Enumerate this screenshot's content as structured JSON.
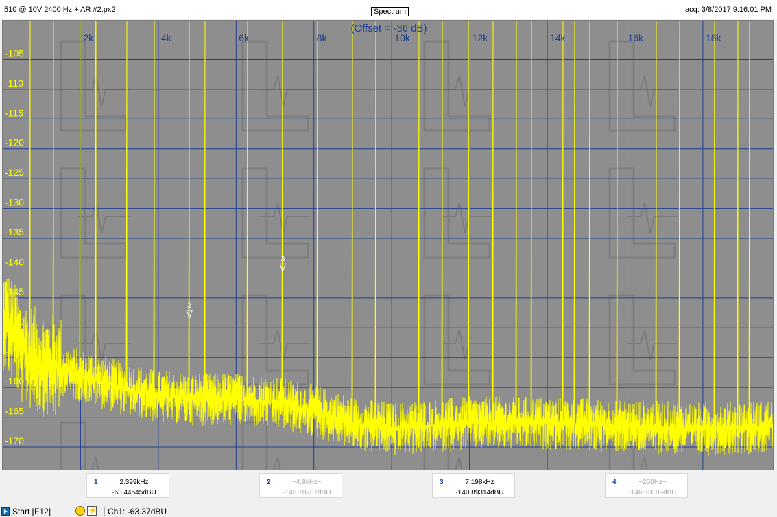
{
  "window": {
    "file_title": "510 @ 10V 2400 Hz + AR #2.px2",
    "view_label": "Spectrum",
    "acq_time": "acq: 3/8/2017 9:16:01 PM"
  },
  "chart_data": {
    "type": "line",
    "title": "(Offset = -36 dB)",
    "xlabel": "",
    "ylabel": "",
    "xlim": [
      0,
      19800
    ],
    "ylim": [
      -173.8,
      -98.5
    ],
    "x_ticks": [
      {
        "value": 2000,
        "label": "2k"
      },
      {
        "value": 4000,
        "label": "4k"
      },
      {
        "value": 6000,
        "label": "6k"
      },
      {
        "value": 8000,
        "label": "8k"
      },
      {
        "value": 10000,
        "label": "10k"
      },
      {
        "value": 12000,
        "label": "12k"
      },
      {
        "value": 14000,
        "label": "14k"
      },
      {
        "value": 16000,
        "label": "16k"
      },
      {
        "value": 18000,
        "label": "18k"
      }
    ],
    "y_ticks": [
      {
        "value": -105,
        "label": "-105"
      },
      {
        "value": -110,
        "label": "-110"
      },
      {
        "value": -115,
        "label": "-115"
      },
      {
        "value": -120,
        "label": "-120"
      },
      {
        "value": -125,
        "label": "-125"
      },
      {
        "value": -130,
        "label": "-130"
      },
      {
        "value": -135,
        "label": "-135"
      },
      {
        "value": -140,
        "label": "-140"
      },
      {
        "value": -145,
        "label": "-145"
      },
      {
        "value": -150,
        "label": "-150"
      },
      {
        "value": -155,
        "label": "-155"
      },
      {
        "value": -160,
        "label": "-160"
      },
      {
        "value": -165,
        "label": "-165"
      },
      {
        "value": -170,
        "label": "-170"
      }
    ],
    "grid": true,
    "trace_color": "#ffff00",
    "background_color": "#8e8e8e",
    "grid_color": "#1f3f8f",
    "series": [
      {
        "noise_floor": [
          [
            0,
            -148
          ],
          [
            200,
            -150
          ],
          [
            500,
            -154
          ],
          [
            1000,
            -156
          ],
          [
            1500,
            -157
          ],
          [
            2000,
            -158
          ],
          [
            3000,
            -160
          ],
          [
            4000,
            -161.5
          ],
          [
            5000,
            -162
          ],
          [
            6000,
            -162
          ],
          [
            7000,
            -162.5
          ],
          [
            8000,
            -164
          ],
          [
            9000,
            -166
          ],
          [
            10000,
            -167
          ],
          [
            12000,
            -166
          ],
          [
            14000,
            -166
          ],
          [
            16000,
            -166.5
          ],
          [
            18000,
            -167
          ],
          [
            19800,
            -166.5
          ]
        ],
        "spikes": [
          {
            "x": 2399,
            "y": -63.4
          },
          {
            "x": 4800,
            "y": -148.7
          },
          {
            "x": 7198,
            "y": -140.9
          },
          {
            "x": 9600,
            "y": -150
          },
          {
            "x": 11998,
            "y": -142
          },
          {
            "x": 14400,
            "y": -136
          },
          {
            "x": 16797,
            "y": -135
          },
          {
            "x": 19196,
            "y": -134.5
          },
          {
            "x": 2000,
            "y": -137.5
          },
          {
            "x": 6300,
            "y": -147.5
          },
          {
            "x": 5200,
            "y": -146.5
          },
          {
            "x": 8100,
            "y": -149
          },
          {
            "x": 9000,
            "y": -151
          },
          {
            "x": 10700,
            "y": -147
          },
          {
            "x": 12600,
            "y": -150
          },
          {
            "x": 13600,
            "y": -149
          },
          {
            "x": 15100,
            "y": -147
          },
          {
            "x": 15800,
            "y": -150
          },
          {
            "x": 17400,
            "y": -151
          },
          {
            "x": 18300,
            "y": -150
          },
          {
            "x": 18900,
            "y": -152
          },
          {
            "x": 700,
            "y": -138
          },
          {
            "x": 1300,
            "y": -145
          },
          {
            "x": 3200,
            "y": -150
          },
          {
            "x": 3900,
            "y": -152
          },
          {
            "x": 11300,
            "y": -151
          },
          {
            "x": 13200,
            "y": -152
          },
          {
            "x": 14700,
            "y": -148
          }
        ]
      }
    ],
    "annotations": [
      {
        "text": "2",
        "x": 4800,
        "y": -148.7
      },
      {
        "text": "3",
        "x": 7198,
        "y": -140.9
      }
    ]
  },
  "markers": [
    {
      "num": "1",
      "freq": "2.399kHz",
      "level": "-63.44545dBU",
      "active": true
    },
    {
      "num": "2",
      "freq": "~4.8kHz~",
      "level": "-148.70287dBU",
      "active": false
    },
    {
      "num": "3",
      "freq": "7.198kHz",
      "level": "-140.89314dBU",
      "active": true
    },
    {
      "num": "4",
      "freq": "~250Hz~",
      "level": "-146.53109dBU",
      "active": false
    }
  ],
  "status": {
    "start_label": "Start [F12]",
    "channel_readout": "Ch1: -63.37dBU"
  }
}
